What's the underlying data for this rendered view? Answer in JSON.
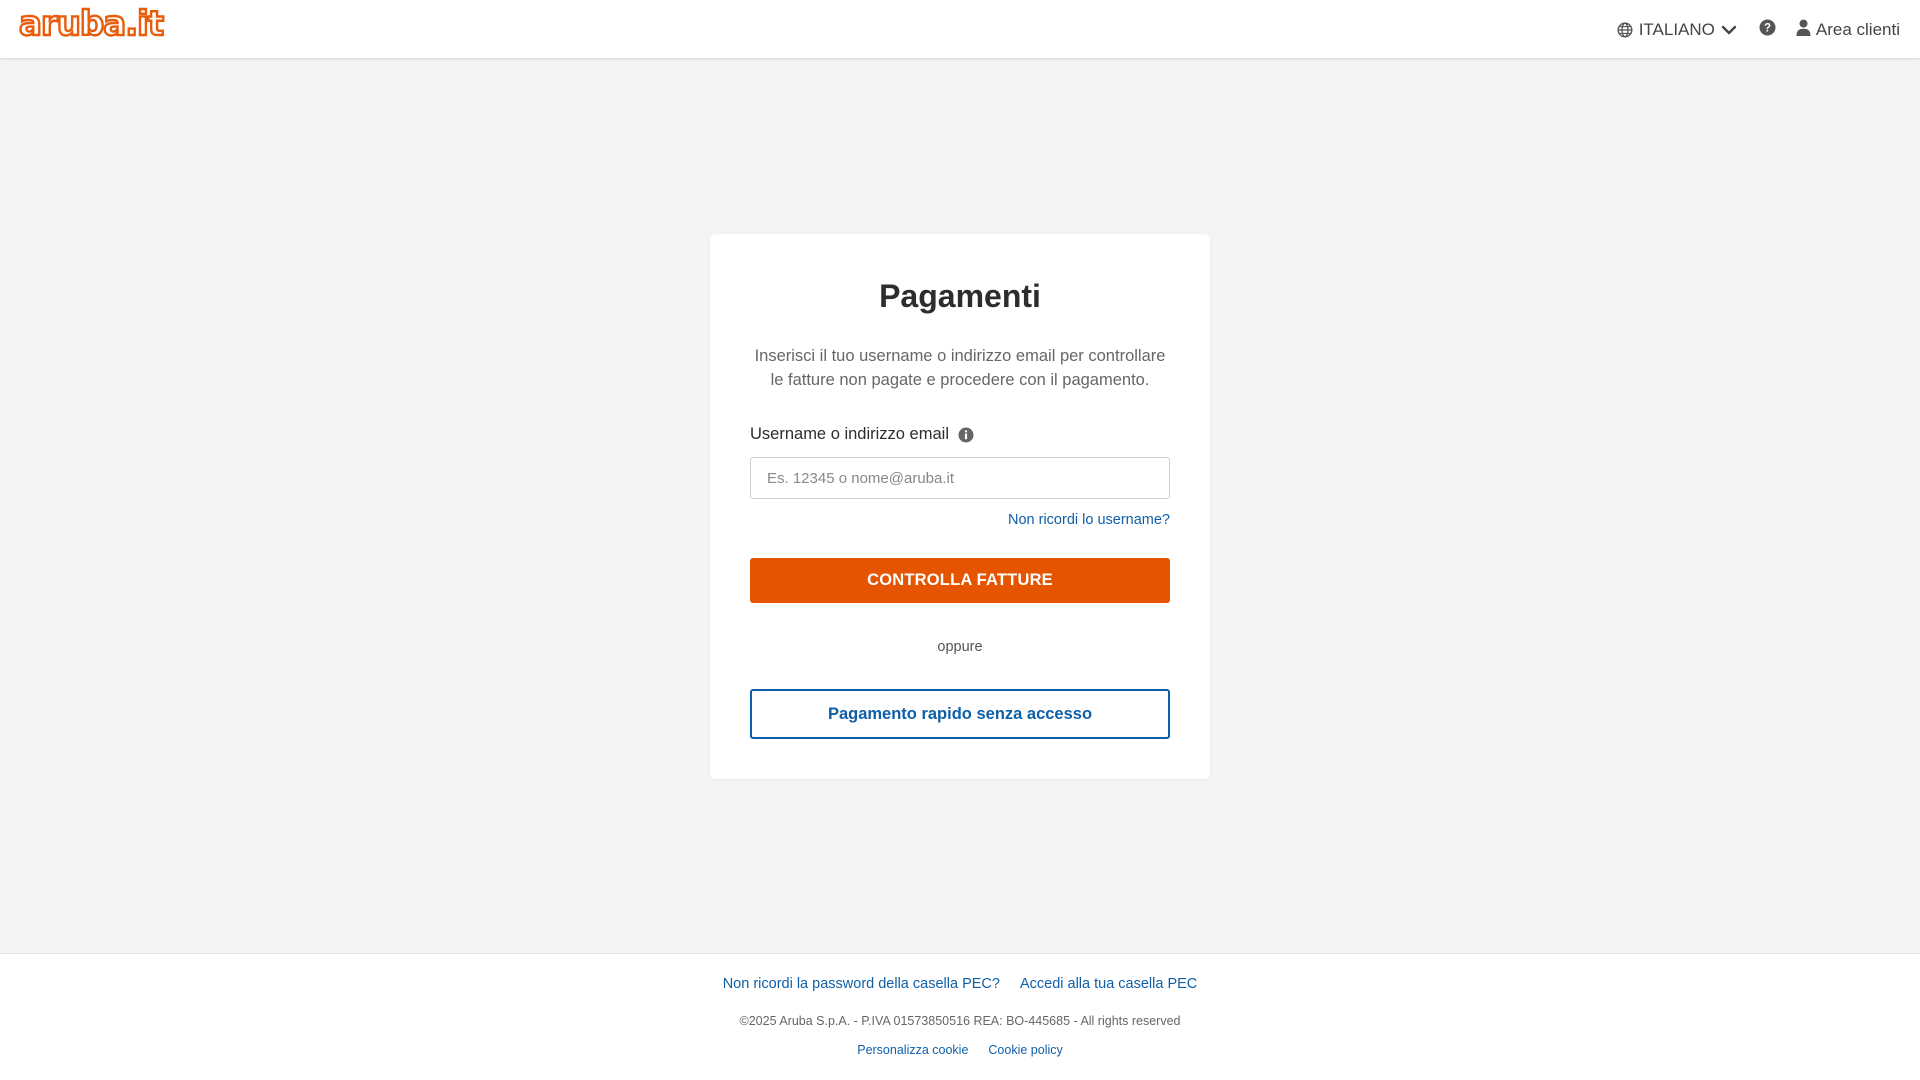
{
  "header": {
    "logo_text": "aruba.it",
    "language_label": "ITALIANO",
    "account_label": "Area clienti",
    "icons": {
      "language": "globe-icon",
      "dropdown": "chevron-down-icon",
      "help": "question-circle-icon",
      "account": "user-icon"
    }
  },
  "main": {
    "title": "Pagamenti",
    "description": "Inserisci il tuo username o indirizzo email per controllare le fatture non pagate e procedere con il pagamento.",
    "field": {
      "label": "Username o indirizzo email",
      "placeholder": "Es. 12345 o nome@aruba.it",
      "value": "",
      "info_icon": "info-circle-icon"
    },
    "forgot_username_link": "Non ricordi lo username?",
    "primary_button_label": "CONTROLLA FATTURE",
    "separator_text": "oppure",
    "secondary_button_label": "Pagamento rapido senza accesso"
  },
  "footer": {
    "links": [
      "Non ricordi la password della casella PEC?",
      "Accedi alla tua casella PEC"
    ],
    "copyright": "©2025 Aruba S.p.A. - P.IVA 01573850516 REA: BO-445685 - All rights reserved",
    "legal_links": [
      "Personalizza cookie",
      "Cookie policy"
    ]
  },
  "colors": {
    "brand_orange": "#e55400",
    "link_blue": "#0f5fa8",
    "background": "#f4f4f4"
  }
}
